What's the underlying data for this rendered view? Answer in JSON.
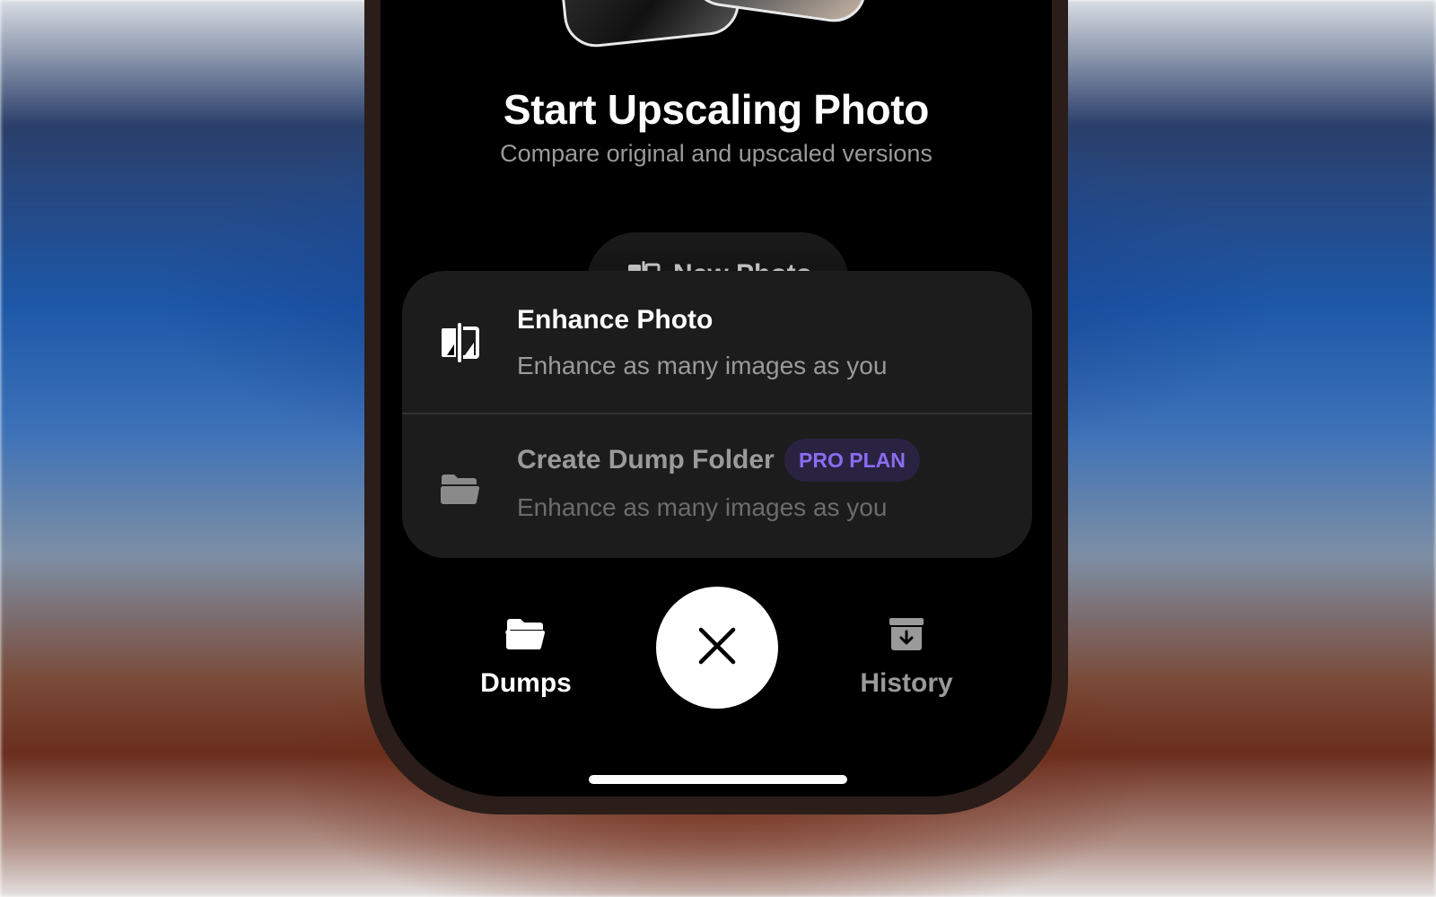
{
  "hero": {
    "title": "Start Upscaling Photo",
    "subtitle": "Compare original and upscaled versions",
    "new_photo_label": "New Photo"
  },
  "sheet": {
    "items": [
      {
        "title": "Enhance Photo",
        "description": "Enhance as many images as you",
        "icon": "compare-icon",
        "enabled": true
      },
      {
        "title": "Create Dump Folder",
        "description": "Enhance as many images as you",
        "icon": "folder-icon",
        "enabled": false,
        "badge": "PRO PLAN"
      }
    ]
  },
  "tabbar": {
    "dumps_label": "Dumps",
    "history_label": "History",
    "center_icon": "close-icon",
    "active": "Dumps"
  },
  "colors": {
    "accent_purple": "#8b6cf2",
    "badge_bg": "#292341",
    "background": "#000000"
  }
}
